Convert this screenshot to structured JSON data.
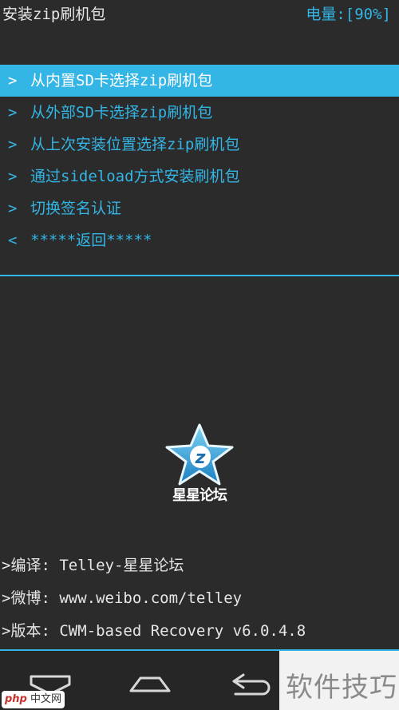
{
  "header": {
    "title": "安装zip刷机包",
    "battery": "电量:[90%]"
  },
  "menu": {
    "items": [
      {
        "arrow": ">",
        "label": "从内置SD卡选择zip刷机包",
        "selected": true
      },
      {
        "arrow": ">",
        "label": "从外部SD卡选择zip刷机包",
        "selected": false
      },
      {
        "arrow": ">",
        "label": "从上次安装位置选择zip刷机包",
        "selected": false
      },
      {
        "arrow": ">",
        "label": "通过sideload方式安装刷机包",
        "selected": false
      },
      {
        "arrow": ">",
        "label": "切换签名认证",
        "selected": false
      },
      {
        "arrow": "<",
        "label": "*****返回*****",
        "selected": false
      }
    ]
  },
  "logo": {
    "caption": "星星论坛",
    "icon": "star-z-logo-icon"
  },
  "info": {
    "translator": ">编译: Telley-星星论坛",
    "weibo": ">微博: www.weibo.com/telley",
    "version": ">版本: CWM-based Recovery v6.0.4.8"
  },
  "navbar": {
    "icons": [
      "home-icon",
      "menu-icon",
      "back-icon"
    ]
  },
  "watermark": {
    "text": "软件技巧",
    "badge_php": "php",
    "badge_site": "中文网"
  },
  "colors": {
    "accent": "#33b5e5",
    "background": "#2b2b2b",
    "text": "#e6e6e6"
  }
}
